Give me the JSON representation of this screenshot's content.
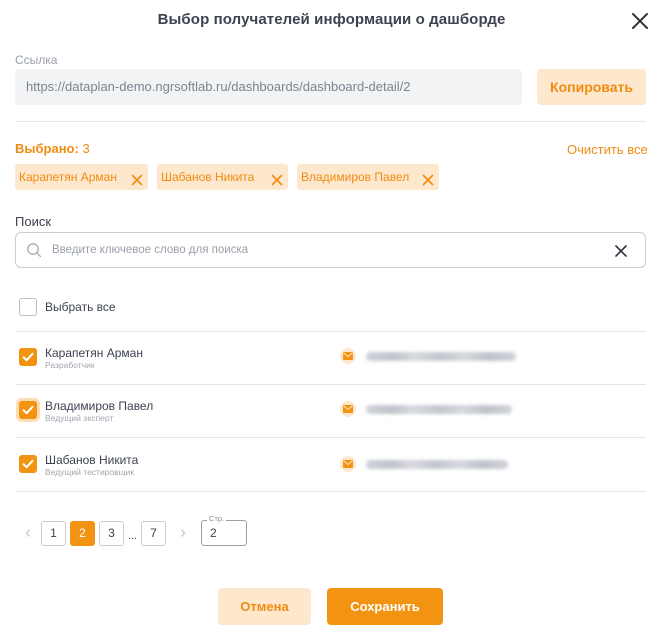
{
  "dialog": {
    "title": "Выбор получателей информации о дашборде",
    "close_icon": "close-icon"
  },
  "link": {
    "label": "Ссылка",
    "value": "https://dataplan-demo.ngrsoftlab.ru/dashboards/dashboard-detail/2",
    "copy_label": "Копировать"
  },
  "selection": {
    "label": "Выбрано:",
    "count": "3",
    "clear_label": "Очистить все",
    "chips": [
      {
        "label": "Карапетян Арман"
      },
      {
        "label": "Шабанов Никита"
      },
      {
        "label": "Владимиров Павел"
      }
    ]
  },
  "search": {
    "label": "Поиск",
    "placeholder": "Введите ключевое слово для поиска",
    "value": ""
  },
  "list": {
    "select_all_label": "Выбрать все",
    "select_all_checked": false,
    "rows": [
      {
        "name": "Карапетян Арман",
        "role": "Разработчик",
        "checked": true,
        "email_icon": "mail-icon"
      },
      {
        "name": "Владимиров Павел",
        "role": "Ведущий эксперт",
        "checked": true,
        "email_icon": "mail-icon"
      },
      {
        "name": "Шабанов Никита",
        "role": "Ведущий тестировщик",
        "checked": true,
        "email_icon": "mail-icon"
      }
    ]
  },
  "pagination": {
    "prev_icon": "chevron-left-icon",
    "next_icon": "chevron-right-icon",
    "pages": [
      "1",
      "2",
      "3",
      "7"
    ],
    "current": "2",
    "ellipsis": "...",
    "page_input_label": "Стр.",
    "page_input_value": "2"
  },
  "footer": {
    "cancel_label": "Отмена",
    "save_label": "Сохранить"
  },
  "colors": {
    "accent": "#f39312",
    "accent_text": "#f08c12",
    "accent_light": "#fde7cd",
    "text": "#3c4250",
    "muted": "#9aa0ab",
    "border": "#c9cdd4"
  }
}
